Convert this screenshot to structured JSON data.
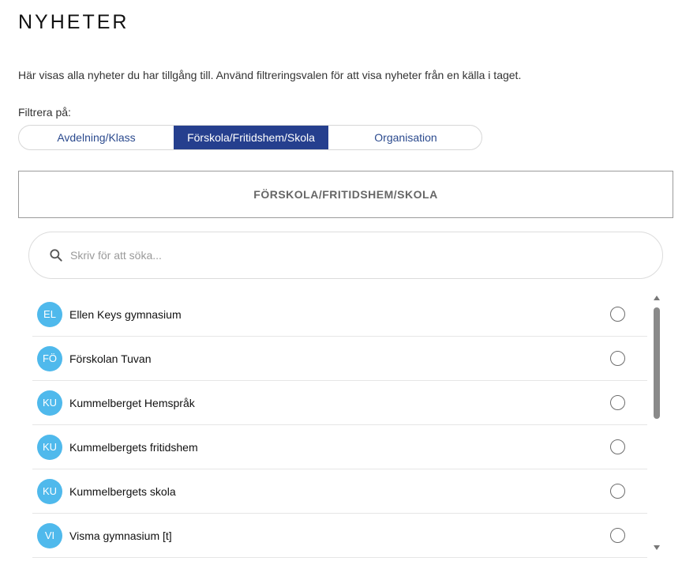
{
  "page": {
    "title": "NYHETER",
    "intro": "Här visas alla nyheter du har tillgång till. Använd filtreringsvalen för att visa nyheter från en källa i taget."
  },
  "filter": {
    "label": "Filtrera på:",
    "segments": [
      "Avdelning/Klass",
      "Förskola/Fritidshem/Skola",
      "Organisation"
    ],
    "active_index": 1
  },
  "section": {
    "heading": "FÖRSKOLA/FRITIDSHEM/SKOLA"
  },
  "search": {
    "placeholder": "Skriv för att söka...",
    "value": ""
  },
  "colors": {
    "accent": "#253f8e",
    "avatar": "#4fb9ec"
  },
  "list": {
    "items": [
      {
        "initials": "EL",
        "label": "Ellen Keys gymnasium",
        "selected": false
      },
      {
        "initials": "FÖ",
        "label": "Förskolan Tuvan",
        "selected": false
      },
      {
        "initials": "KU",
        "label": "Kummelberget Hemspråk",
        "selected": false
      },
      {
        "initials": "KU",
        "label": "Kummelbergets fritidshem",
        "selected": false
      },
      {
        "initials": "KU",
        "label": "Kummelbergets skola",
        "selected": false
      },
      {
        "initials": "VI",
        "label": "Visma gymnasium [t]",
        "selected": false
      }
    ]
  }
}
